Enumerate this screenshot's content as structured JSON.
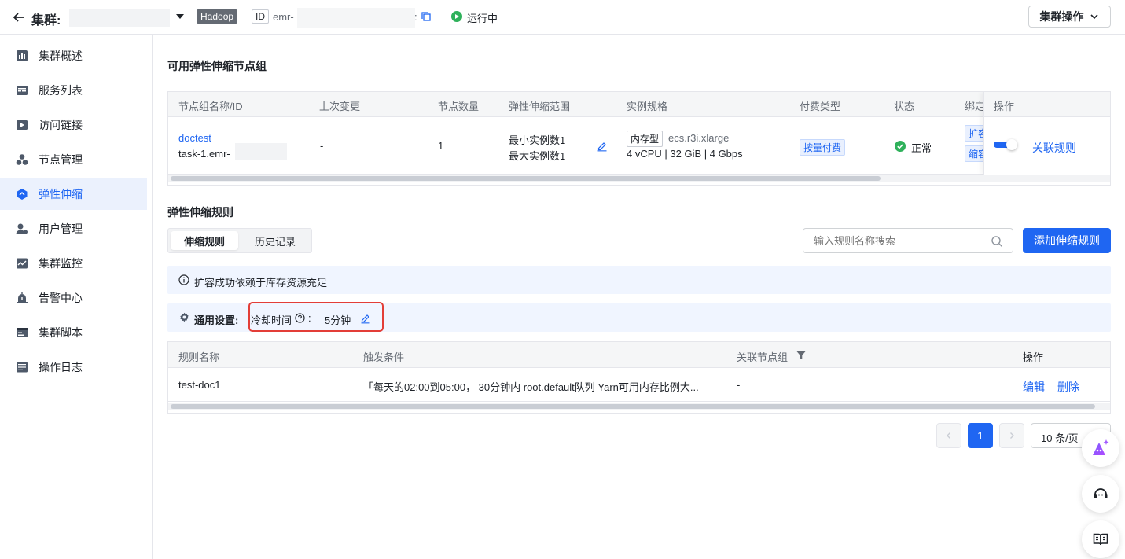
{
  "header": {
    "back_label": "集群:",
    "cluster_name_masked": "",
    "cluster_type": "Hadoop",
    "id_label": "ID",
    "id_value": "emr-",
    "id_suffix": ":",
    "status": "运行中",
    "actions_button": "集群操作"
  },
  "sidebar": {
    "items": [
      {
        "label": "集群概述",
        "icon": "chart-icon"
      },
      {
        "label": "服务列表",
        "icon": "list-icon"
      },
      {
        "label": "访问链接",
        "icon": "play-icon"
      },
      {
        "label": "节点管理",
        "icon": "nodes-icon"
      },
      {
        "label": "弹性伸缩",
        "icon": "scaling-icon",
        "active": true
      },
      {
        "label": "用户管理",
        "icon": "user-settings-icon"
      },
      {
        "label": "集群监控",
        "icon": "monitor-icon"
      },
      {
        "label": "告警中心",
        "icon": "alarm-icon"
      },
      {
        "label": "集群脚本",
        "icon": "script-icon"
      },
      {
        "label": "操作日志",
        "icon": "log-icon"
      }
    ]
  },
  "node_groups": {
    "title": "可用弹性伸缩节点组",
    "columns": [
      "节点组名称/ID",
      "上次变更",
      "节点数量",
      "弹性伸缩范围",
      "实例规格",
      "付费类型",
      "状态",
      "绑定",
      "操作"
    ],
    "row": {
      "name": "doctest",
      "id": "task-1.emr-",
      "last_change": "-",
      "node_count": "1",
      "min_instances": "最小实例数1",
      "max_instances": "最大实例数1",
      "instance_tag": "内存型",
      "instance_type": "ecs.r3i.xlarge",
      "instance_spec": "4 vCPU | 32 GiB | 4 Gbps",
      "billing": "按量付费",
      "status": "正常",
      "bind_tag_1": "扩容",
      "bind_tag_2": "缩容",
      "action_link": "关联规则"
    }
  },
  "rules": {
    "title": "弹性伸缩规则",
    "tabs": [
      "伸缩规则",
      "历史记录"
    ],
    "active_tab": "伸缩规则",
    "search_placeholder": "输入规则名称搜索",
    "add_button": "添加伸缩规则",
    "notice": "扩容成功依赖于库存资源充足",
    "settings_label": "通用设置:",
    "cooldown_label": "冷却时间",
    "cooldown_sep": ":",
    "cooldown_value": "5分钟",
    "columns": [
      "规则名称",
      "触发条件",
      "关联节点组",
      "操作"
    ],
    "row": {
      "name": "test-doc1",
      "condition": "「每天的02:00到05:00， 30分钟内 root.default队列 Yarn可用内存比例大...",
      "node_group": "-",
      "edit": "编辑",
      "delete": "删除"
    }
  },
  "pagination": {
    "current_page": "1",
    "page_size": "10 条/页"
  },
  "colors": {
    "primary": "#1f66f2",
    "success": "#2fb15b",
    "highlight_border": "#e33e38"
  }
}
